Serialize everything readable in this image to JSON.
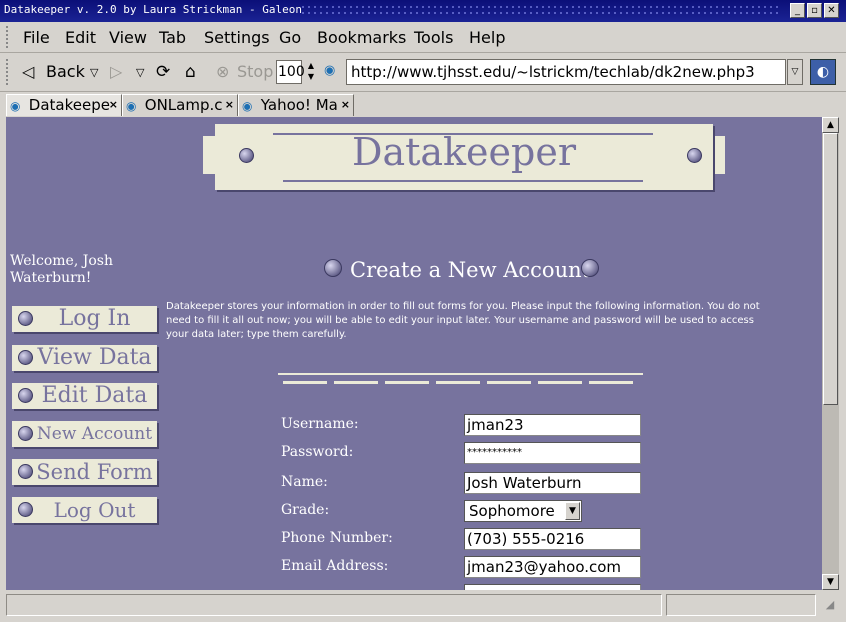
{
  "window": {
    "title": "Datakeeper v. 2.0 by Laura Strickman - Galeon"
  },
  "menu": [
    "File",
    "Edit",
    "View",
    "Tab",
    "Settings",
    "Go",
    "Bookmarks",
    "Tools",
    "Help"
  ],
  "toolbar": {
    "back_label": "Back",
    "stop_label": "Stop",
    "zoom": "100",
    "url": "http://www.tjhsst.edu/~lstrickm/techlab/dk2new.php3"
  },
  "tabs": [
    {
      "label": "Datakeepe"
    },
    {
      "label": "ONLamp.c"
    },
    {
      "label": "Yahoo! Ma"
    }
  ],
  "page": {
    "banner_title": "Datakeeper",
    "welcome": "Welcome, Josh Waterburn!",
    "nav": [
      "Log In",
      "View Data",
      "Edit Data",
      "New Account",
      "Send Form",
      "Log Out"
    ],
    "heading": "Create a New Account",
    "intro": "Datakeeper stores your information in order to fill out forms for you. Please input the following information. You do not need to fill it all out now; you will be able to edit your input later. Your username and password will be used to access your data later; type them carefully.",
    "form": {
      "username_label": "Username:",
      "username": "jman23",
      "password_label": "Password:",
      "password": "***********",
      "name_label": "Name:",
      "name": "Josh Waterburn",
      "grade_label": "Grade:",
      "grade": "Sophomore",
      "phone_label": "Phone Number:",
      "phone": "(703) 555-0216",
      "email_label": "Email Address:",
      "email": "jman23@yahoo.com"
    }
  },
  "colors": {
    "page_bg": "#77739e",
    "plate": "#ebead8",
    "titlebar": "#0b0f78"
  }
}
